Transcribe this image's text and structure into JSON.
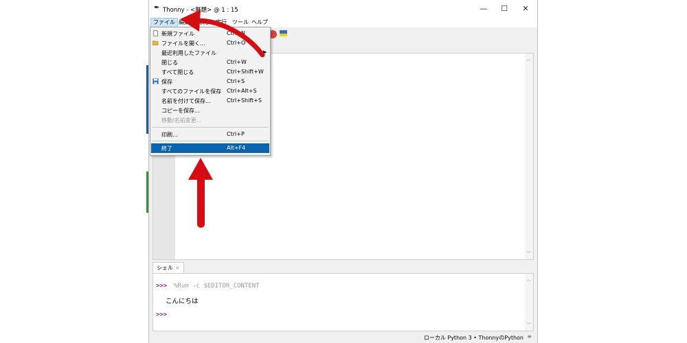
{
  "window": {
    "title": "Thonny  -  <無題>  @  1 : 15",
    "minimize": "—",
    "maximize": "☐",
    "close": "✕"
  },
  "menubar": {
    "items": [
      "ファイル",
      "編集",
      "表示",
      "実行",
      "ツール",
      "ヘルプ"
    ]
  },
  "file_menu": {
    "items": [
      {
        "label": "新規ファイル",
        "accel": "Ctrl+N",
        "icon": "new-file-icon"
      },
      {
        "label": "ファイルを開く...",
        "accel": "Ctrl+O",
        "icon": "folder-open-icon"
      },
      {
        "label": "最近利用したファイル",
        "accel": "",
        "submenu": true
      },
      {
        "label": "閉じる",
        "accel": "Ctrl+W"
      },
      {
        "label": "すべて閉じる",
        "accel": "Ctrl+Shift+W"
      },
      {
        "label": "保存",
        "accel": "Ctrl+S",
        "icon": "save-icon"
      },
      {
        "label": "すべてのファイルを保存",
        "accel": "Ctrl+Alt+S"
      },
      {
        "label": "名前を付けて保存...",
        "accel": "Ctrl+Shift+S"
      },
      {
        "label": "コピーを保存...",
        "accel": ""
      },
      {
        "label": "移動/名前変更...",
        "accel": "",
        "disabled": true
      },
      {
        "label": "印刷...",
        "accel": "Ctrl+P"
      },
      {
        "label": "終了",
        "accel": "Alt+F4",
        "highlighted": true
      }
    ]
  },
  "shell": {
    "tab_label": "シェル",
    "tab_close": "×",
    "prompt": ">>>",
    "command": "%Run -c $EDITOR_CONTENT",
    "output": "こんにちは"
  },
  "statusbar": {
    "text": "ローカル Python 3  •  ThonnyのPython",
    "grip": "≡"
  },
  "colors": {
    "highlight": "#0a64ad",
    "arrow": "#d40d12",
    "prompt": "#8b1a8b"
  }
}
